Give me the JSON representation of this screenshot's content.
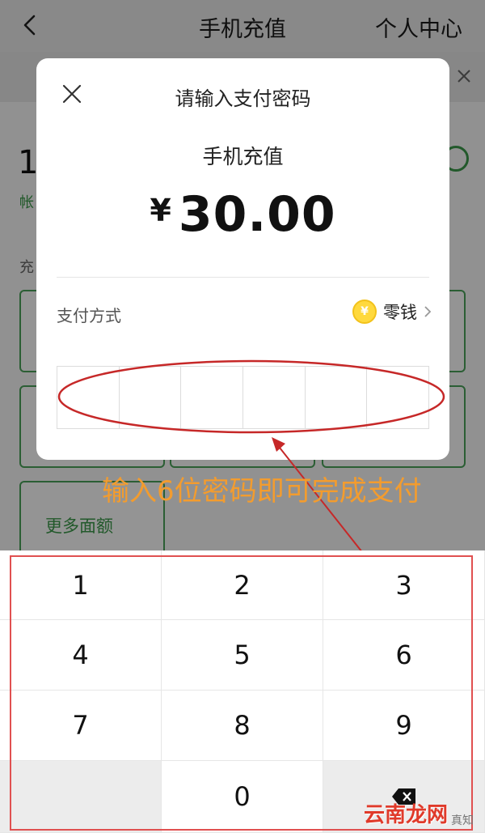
{
  "nav": {
    "title": "手机充值",
    "right": "个人中心"
  },
  "page": {
    "phone_prefix": "1",
    "account_hint": "帐",
    "charge_label": "充",
    "more_label": "更多面额"
  },
  "dialog": {
    "title": "请输入支付密码",
    "item": "手机充值",
    "currency": "¥",
    "amount": "30.00",
    "pay_method_label": "支付方式",
    "pay_method": "零钱",
    "coin_symbol": "¥",
    "password_length": 6
  },
  "annotation": {
    "text": "输入6位密码即可完成支付"
  },
  "keypad": {
    "keys": [
      "1",
      "2",
      "3",
      "4",
      "5",
      "6",
      "7",
      "8",
      "9",
      "",
      "0",
      ""
    ]
  },
  "watermark": {
    "main": "云南龙网",
    "sub": "真知"
  },
  "colors": {
    "accent_green": "#4aa35a",
    "annotation_orange": "#f39c2e",
    "annotation_red": "#c62828",
    "keypad_frame": "#e05050",
    "coin": "#ffd93d"
  }
}
